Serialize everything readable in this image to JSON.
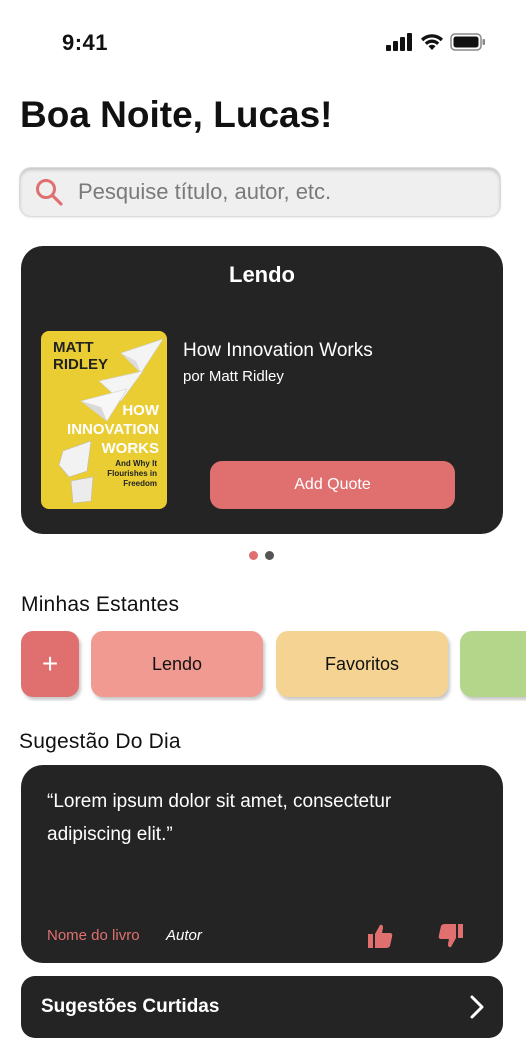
{
  "status": {
    "time": "9:41"
  },
  "greeting": "Boa Noite, Lucas!",
  "search": {
    "placeholder": "Pesquise título, autor, etc."
  },
  "reading": {
    "title": "Lendo",
    "cover": {
      "author": "MATT RIDLEY",
      "title_lines": [
        "HOW",
        "INNOVATION",
        "WORKS"
      ],
      "subtitle_lines": [
        "And Why It",
        "Flourishes in",
        "Freedom"
      ]
    },
    "book_title": "How Innovation Works",
    "book_author": "por Matt Ridley",
    "add_quote_label": "Add Quote",
    "pager": {
      "pages": 2,
      "active": 0
    }
  },
  "shelves": {
    "title": "Minhas Estantes",
    "add_label": "+",
    "items": [
      {
        "label": "Lendo",
        "color": "#f09a92"
      },
      {
        "label": "Favoritos",
        "color": "#f5d393"
      },
      {
        "label": "",
        "color": "#b3d68a"
      }
    ]
  },
  "suggestion": {
    "title": "Sugestão Do Dia",
    "quote": "“Lorem ipsum dolor sit amet, consectetur adipiscing elit.”",
    "book": "Nome do livro",
    "author": "Autor"
  },
  "liked": {
    "label": "Sugestões Curtidas"
  },
  "colors": {
    "accent": "#e07070",
    "dark_card": "#242424",
    "dot_inactive": "#555555"
  }
}
